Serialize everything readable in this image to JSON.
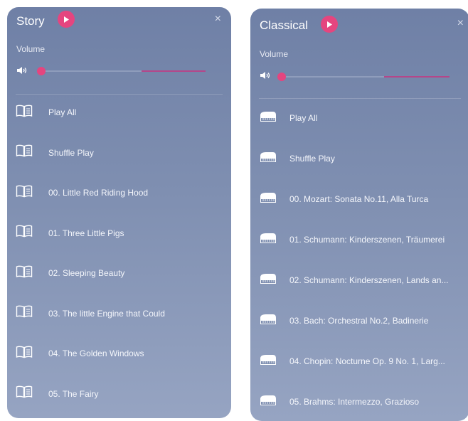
{
  "panels": [
    {
      "title": "Story",
      "volume_label": "Volume",
      "close_glyph": "×",
      "items": [
        "Play All",
        "Shuffle Play",
        "00. Little Red Riding Hood",
        "01. Three Little Pigs",
        "02. Sleeping Beauty",
        "03. The little Engine that Could",
        "04. The Golden Windows",
        "05. The Fairy"
      ]
    },
    {
      "title": "Classical",
      "volume_label": "Volume",
      "close_glyph": "×",
      "items": [
        "Play All",
        "Shuffle Play",
        "00. Mozart: Sonata No.11, Alla Turca",
        "01. Schumann: Kinderszenen, Träumerei",
        "02. Schumann: Kinderszenen, Lands an...",
        "03. Bach: Orchestral No.2, Badinerie",
        "04. Chopin: Nocturne Op. 9 No. 1, Larg...",
        "05. Brahms: Intermezzo, Grazioso"
      ]
    }
  ],
  "icons": {
    "story_list_icon": "book-icon",
    "classical_list_icon": "piano-icon",
    "play": "play-icon",
    "speaker": "speaker-icon",
    "close": "close-icon"
  },
  "colors": {
    "accent": "#e5457f",
    "panel_top": "#6f80a6",
    "panel_bottom": "#96a4c2"
  }
}
